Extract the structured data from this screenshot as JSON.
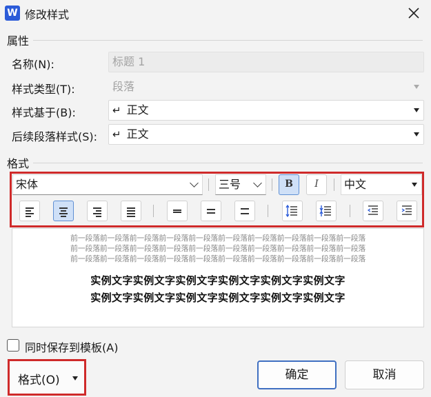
{
  "window": {
    "app_icon_letter": "W",
    "title": "修改样式"
  },
  "properties": {
    "group_label": "属性",
    "name_label": "名称(N):",
    "name_value": "标题 1",
    "style_type_label": "样式类型(T):",
    "style_type_value": "段落",
    "based_on_label": "样式基于(B):",
    "based_on_value": "正文",
    "next_style_label": "后续段落样式(S):",
    "next_style_value": "正文",
    "paragraph_mark": "↵"
  },
  "format": {
    "group_label": "格式",
    "font": "宋体",
    "size": "三号",
    "bold_label": "B",
    "italic_label": "I",
    "script": "中文",
    "bold_active": true,
    "alignment_selected": "center"
  },
  "preview": {
    "previous_paragraph_lines": [
      "前一段落前一段落前一段落前一段落前一段落前一段落前一段落前一段落前一段落前一段落",
      "前一段落前一段落前一段落前一段落前一段落前一段落前一段落前一段落前一段落前一段落",
      "前一段落前一段落前一段落前一段落前一段落前一段落前一段落前一段落前一段落前一段落"
    ],
    "sample_lines": [
      "实例文字实例文字实例文字实例文字实例文字实例文字",
      "实例文字实例文字实例文字实例文字实例文字实例文字"
    ]
  },
  "footer": {
    "save_to_template_label": "同时保存到模板(A)",
    "save_to_template_checked": false,
    "format_button_label": "格式(O)",
    "ok_label": "确定",
    "cancel_label": "取消"
  },
  "colors": {
    "highlight_border": "#cf2a2a",
    "primary_border": "#3f6fc1",
    "active_button": "#cfe0f7"
  }
}
